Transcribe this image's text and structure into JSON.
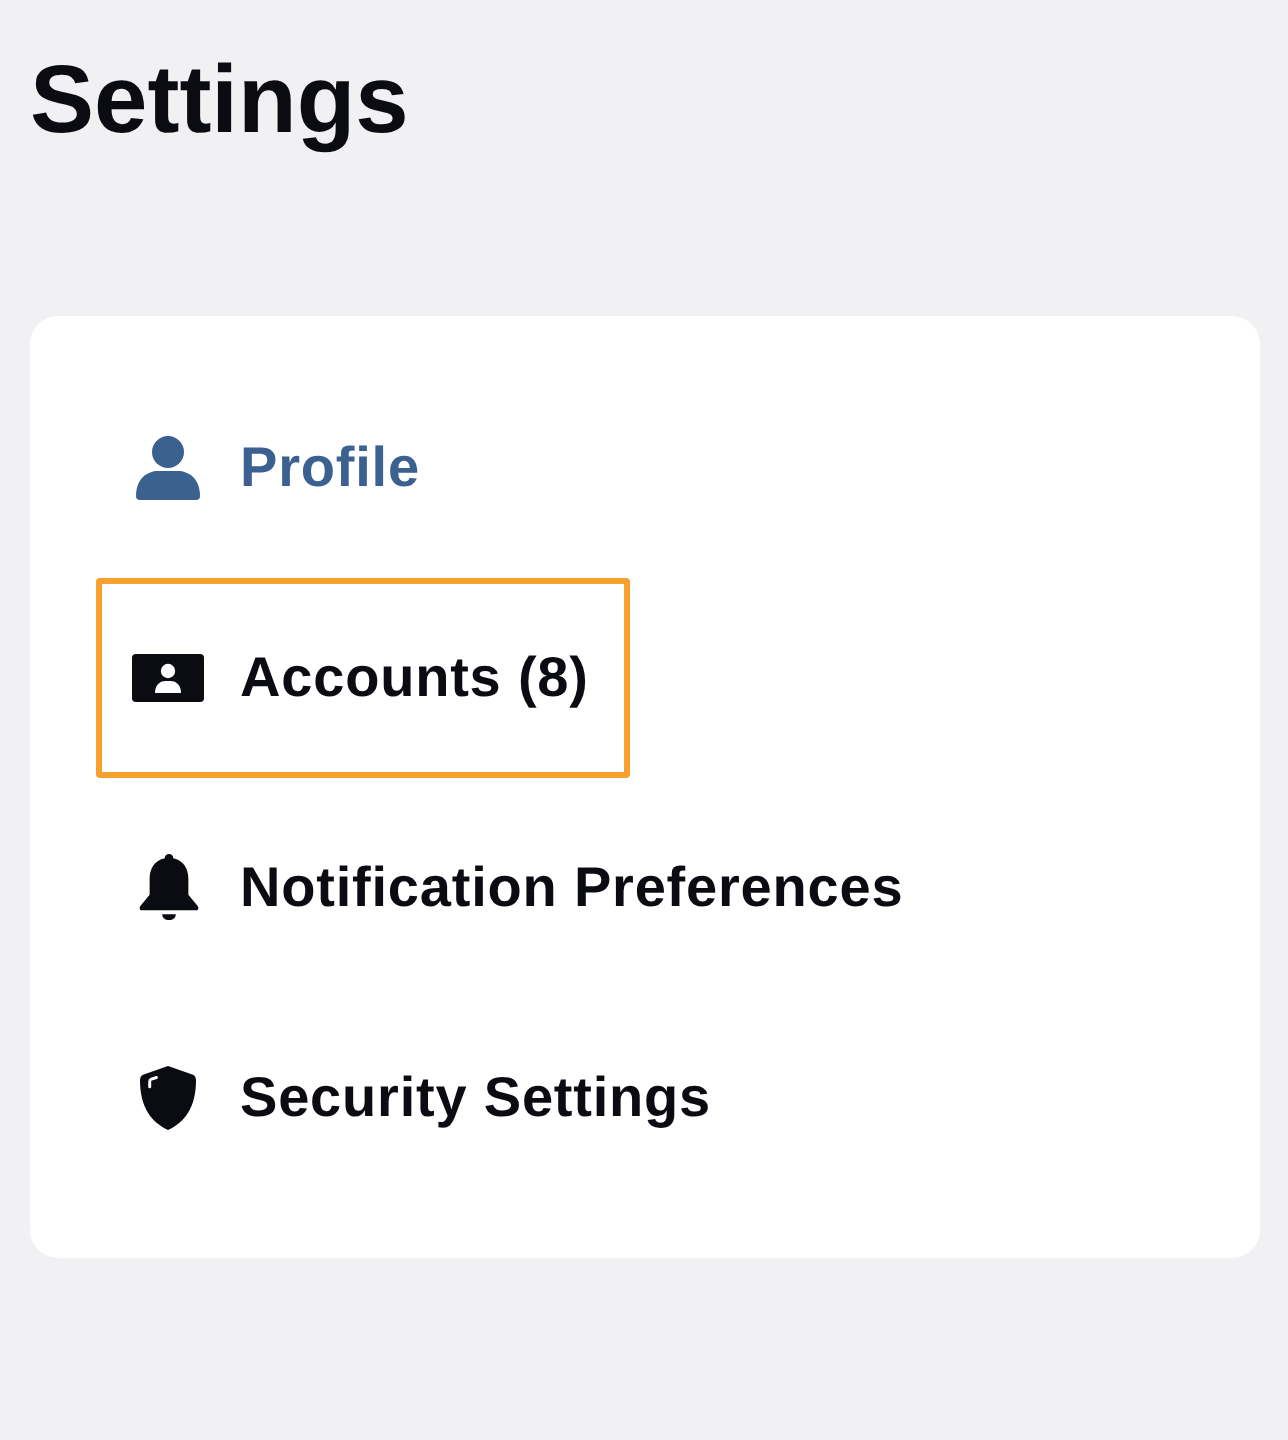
{
  "title": "Settings",
  "menu": {
    "items": [
      {
        "label": "Profile",
        "kind": "profile",
        "selected": true,
        "focused": false
      },
      {
        "label": "Accounts (8)",
        "kind": "id-card",
        "selected": false,
        "focused": true
      },
      {
        "label": "Notification Preferences",
        "kind": "bell",
        "selected": false,
        "focused": false
      },
      {
        "label": "Security Settings",
        "kind": "shield",
        "selected": false,
        "focused": false
      }
    ]
  }
}
